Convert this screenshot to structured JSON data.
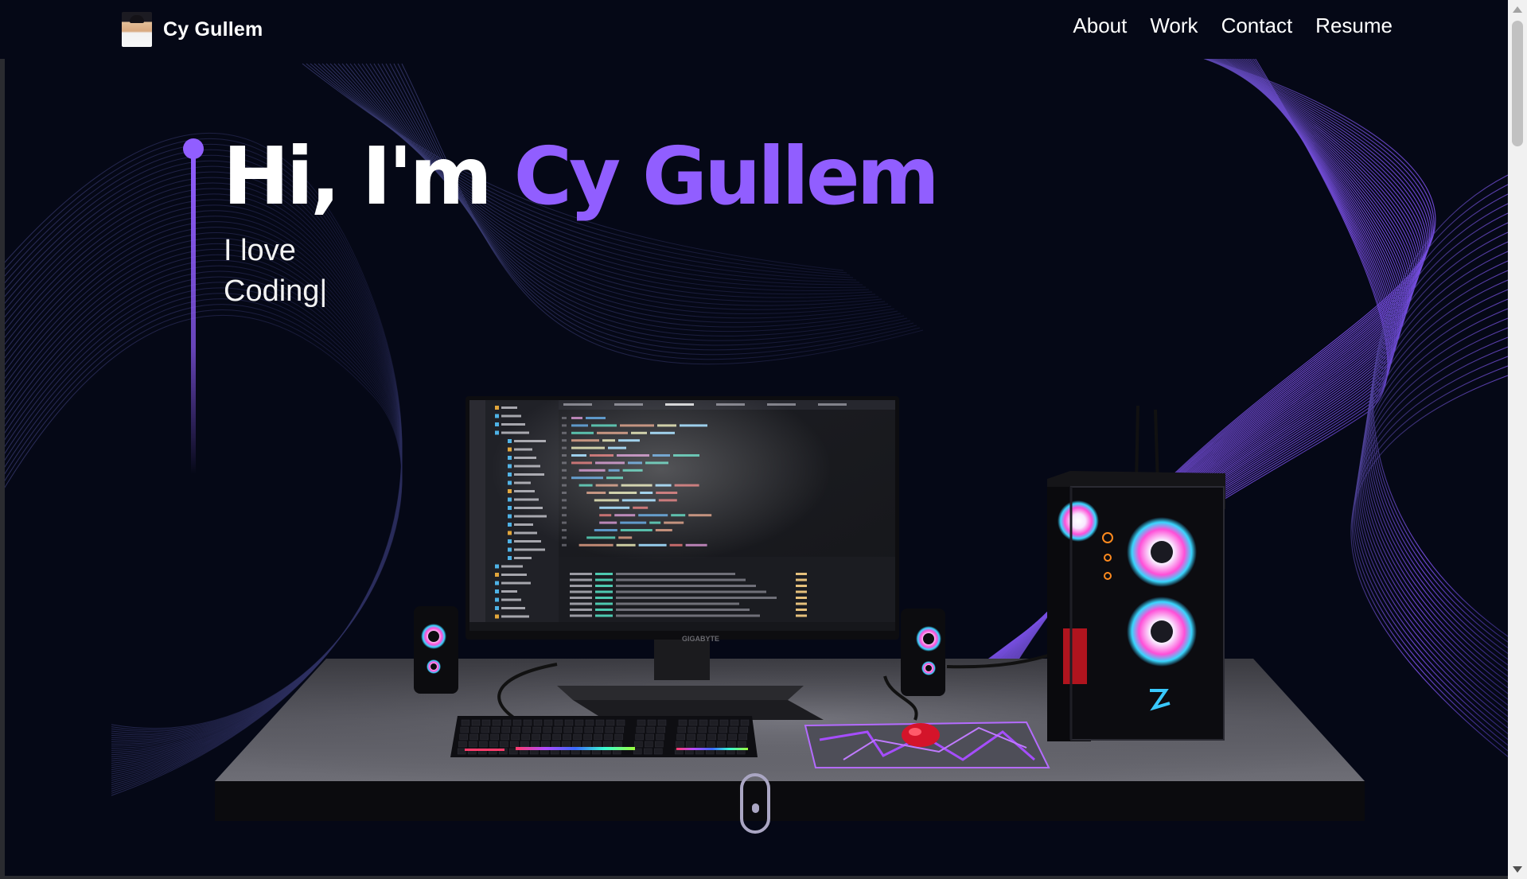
{
  "navbar": {
    "brand_name": "Cy Gullem",
    "links": [
      {
        "label": "About"
      },
      {
        "label": "Work"
      },
      {
        "label": "Contact"
      },
      {
        "label": "Resume"
      }
    ]
  },
  "hero": {
    "title_prefix": "Hi, I'm ",
    "title_name": "Cy Gullem",
    "subtitle_line1": "I love",
    "subtitle_line2": "Coding",
    "cursor": "|"
  },
  "monitor": {
    "brand": "GIGABYTE"
  },
  "colors": {
    "background": "#050816",
    "accent": "#915eff",
    "text": "#ffffff",
    "scroll_indicator": "#aaa6c3"
  },
  "icons": {
    "scroll": "mouse-scroll-icon"
  }
}
